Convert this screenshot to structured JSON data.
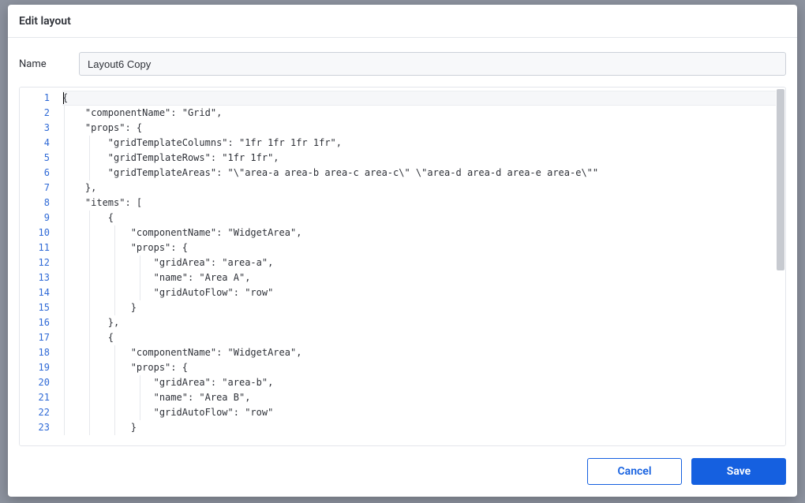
{
  "modal": {
    "title": "Edit layout",
    "name_label": "Name",
    "name_value": "Layout6 Copy"
  },
  "footer": {
    "cancel": "Cancel",
    "save": "Save"
  },
  "editor": {
    "lines": [
      "{",
      "    \"componentName\": \"Grid\",",
      "    \"props\": {",
      "        \"gridTemplateColumns\": \"1fr 1fr 1fr 1fr\",",
      "        \"gridTemplateRows\": \"1fr 1fr\",",
      "        \"gridTemplateAreas\": \"\\\"area-a area-b area-c area-c\\\" \\\"area-d area-d area-e area-e\\\"\"",
      "    },",
      "    \"items\": [",
      "        {",
      "            \"componentName\": \"WidgetArea\",",
      "            \"props\": {",
      "                \"gridArea\": \"area-a\",",
      "                \"name\": \"Area A\",",
      "                \"gridAutoFlow\": \"row\"",
      "            }",
      "        },",
      "        {",
      "            \"componentName\": \"WidgetArea\",",
      "            \"props\": {",
      "                \"gridArea\": \"area-b\",",
      "                \"name\": \"Area B\",",
      "                \"gridAutoFlow\": \"row\"",
      "            }"
    ]
  }
}
